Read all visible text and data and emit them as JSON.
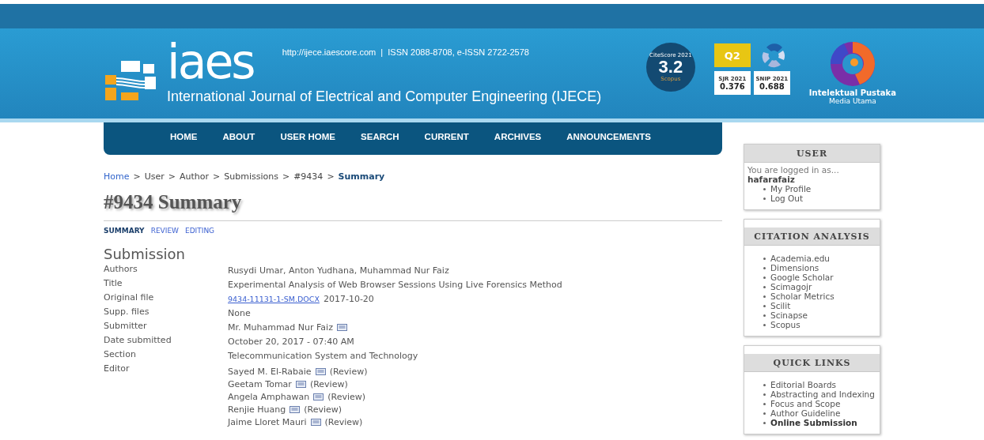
{
  "header": {
    "logo_text": "iaes",
    "url_line": "http://ijece.iaescore.com  |  ISSN 2088-8708, e-ISSN 2722-2578",
    "journal_title": "International Journal of Electrical and Computer Engineering (IJECE)",
    "citescore": {
      "label": "CiteScore 2021",
      "value": "3.2",
      "source": "Scopus"
    },
    "quartile": "Q2",
    "metrics": [
      {
        "label": "SJR 2021",
        "value": "0.376"
      },
      {
        "label": "SNIP 2021",
        "value": "0.688"
      }
    ],
    "publisher": {
      "name": "Intelektual Pustaka",
      "tagline": "Media Utama"
    }
  },
  "nav": [
    "HOME",
    "ABOUT",
    "USER HOME",
    "SEARCH",
    "CURRENT",
    "ARCHIVES",
    "ANNOUNCEMENTS"
  ],
  "breadcrumb": [
    {
      "kind": "link",
      "label": "Home"
    },
    {
      "kind": "separator",
      "label": ">"
    },
    {
      "kind": "text",
      "label": "User"
    },
    {
      "kind": "separator",
      "label": ">"
    },
    {
      "kind": "text",
      "label": "Author"
    },
    {
      "kind": "separator",
      "label": ">"
    },
    {
      "kind": "text",
      "label": "Submissions"
    },
    {
      "kind": "separator",
      "label": ">"
    },
    {
      "kind": "text",
      "label": "#9434"
    },
    {
      "kind": "separator",
      "label": ">"
    },
    {
      "kind": "current",
      "label": "Summary"
    }
  ],
  "page_title": "#9434 Summary",
  "subtabs": [
    {
      "label": "SUMMARY",
      "selected": true
    },
    {
      "label": "REVIEW",
      "selected": false
    },
    {
      "label": "EDITING",
      "selected": false
    }
  ],
  "section_title": "Submission",
  "fields": [
    {
      "kind": "text",
      "label": "Authors",
      "value": "Rusydi Umar, Anton Yudhana, Muhammad Nur Faiz"
    },
    {
      "kind": "text",
      "label": "Title",
      "value": "Experimental Analysis of Web Browser Sessions Using Live Forensics Method"
    },
    {
      "kind": "file",
      "label": "Original file",
      "file": "9434-11131-1-SM.DOCX",
      "date": "2017-10-20"
    },
    {
      "kind": "text",
      "label": "Supp. files",
      "value": "None"
    },
    {
      "kind": "person",
      "label": "Submitter",
      "value": "Mr. Muhammad Nur Faiz"
    },
    {
      "kind": "text",
      "label": "Date submitted",
      "value": "October 20, 2017 - 07:40 AM"
    },
    {
      "kind": "text",
      "label": "Section",
      "value": "Telecommunication System and Technology"
    },
    {
      "kind": "editors",
      "label": "Editor",
      "editors": [
        {
          "name": "Sayed M. El-Rabaie",
          "role": "(Review)"
        },
        {
          "name": "Geetam Tomar",
          "role": "(Review)"
        },
        {
          "name": "Angela Amphawan",
          "role": "(Review)"
        },
        {
          "name": "Renjie Huang",
          "role": "(Review)"
        },
        {
          "name": "Jaime Lloret Mauri",
          "role": "(Review)"
        }
      ]
    }
  ],
  "sidebar": [
    {
      "title": "USER",
      "intro": "You are logged in as...",
      "username": "hafarafaiz",
      "items": [
        {
          "label": "My Profile",
          "bold": false
        },
        {
          "label": "Log Out",
          "bold": false
        }
      ]
    },
    {
      "title": "CITATION ANALYSIS",
      "items": [
        {
          "label": "Academia.edu",
          "bold": false
        },
        {
          "label": "Dimensions",
          "bold": false
        },
        {
          "label": "Google Scholar",
          "bold": false
        },
        {
          "label": "Scimagojr",
          "bold": false
        },
        {
          "label": "Scholar Metrics",
          "bold": false
        },
        {
          "label": "Scilit",
          "bold": false
        },
        {
          "label": "Scinapse",
          "bold": false
        },
        {
          "label": "Scopus",
          "bold": false
        }
      ]
    },
    {
      "title": "QUICK LINKS",
      "items": [
        {
          "label": "Editorial Boards",
          "bold": false
        },
        {
          "label": "Abstracting and Indexing",
          "bold": false
        },
        {
          "label": "Focus and Scope",
          "bold": false
        },
        {
          "label": "Author Guideline",
          "bold": false
        },
        {
          "label": "Online Submission",
          "bold": true
        }
      ]
    }
  ]
}
